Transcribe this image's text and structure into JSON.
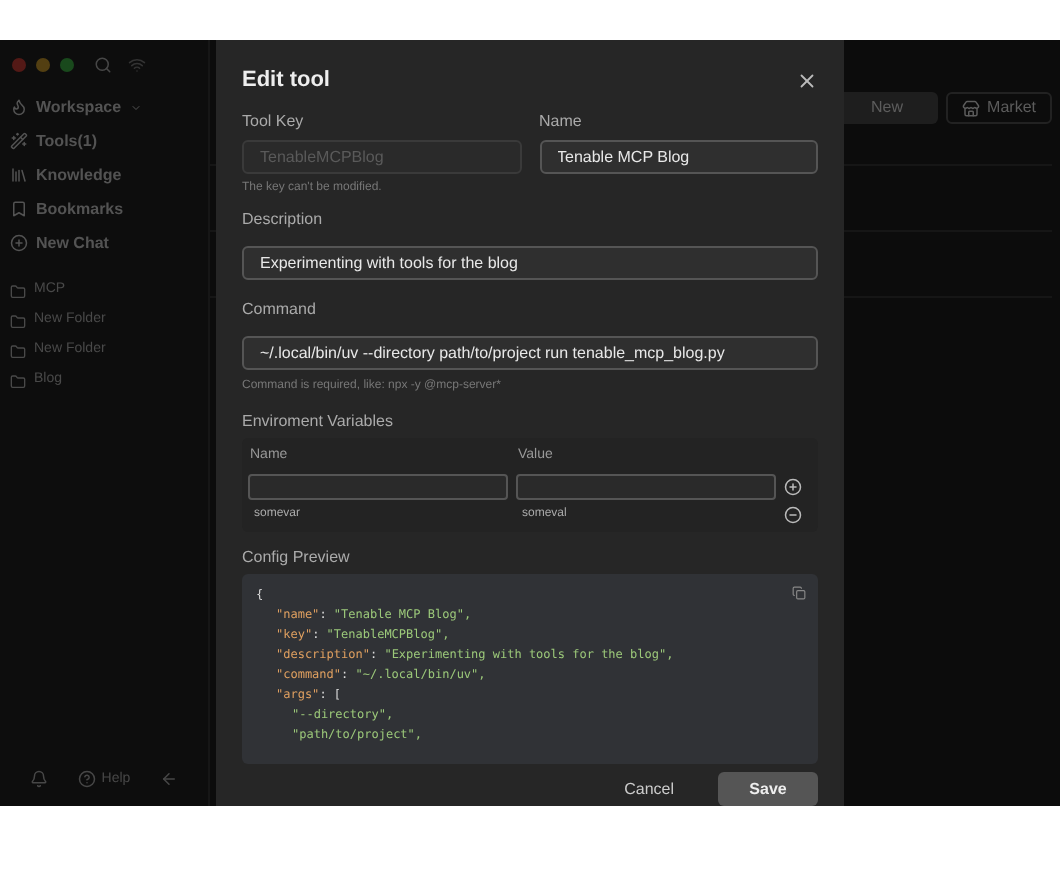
{
  "sidebar": {
    "items": [
      {
        "kind": "workspace",
        "label": "Workspace"
      },
      {
        "kind": "tools",
        "label": "Tools(1)"
      },
      {
        "kind": "knowledge",
        "label": "Knowledge"
      },
      {
        "kind": "bookmarks",
        "label": "Bookmarks"
      },
      {
        "kind": "new-chat",
        "label": "New Chat"
      }
    ],
    "folders": [
      "MCP",
      "New Folder",
      "New Folder",
      "Blog"
    ],
    "footer": {
      "help": "Help"
    }
  },
  "toolbar": {
    "new": "New",
    "market": "Market"
  },
  "dialog": {
    "title": "Edit tool",
    "tool_key": {
      "label": "Tool Key",
      "placeholder": "TenableMCPBlog",
      "disabled": true,
      "hint": "The key can't be modified."
    },
    "name": {
      "label": "Name",
      "value": "Tenable MCP Blog"
    },
    "description": {
      "label": "Description",
      "value": "Experimenting with tools for the blog"
    },
    "command": {
      "label": "Command",
      "value": "~/.local/bin/uv --directory path/to/project run tenable_mcp_blog.py",
      "hint": "Command is required, like: npx -y @mcp-server*"
    },
    "env": {
      "label": "Enviroment Variables",
      "columns": [
        "Name",
        "Value"
      ],
      "rows": [
        {
          "name": "somevar",
          "value": "someval"
        }
      ]
    },
    "preview": {
      "label": "Config Preview",
      "lines": [
        {
          "kind": "brace",
          "text": "{"
        },
        {
          "kind": "pair",
          "key": "\"name\"",
          "sep": ": ",
          "value": "\"Tenable MCP Blog\","
        },
        {
          "kind": "pair",
          "key": "\"key\"",
          "sep": ": ",
          "value": "\"TenableMCPBlog\","
        },
        {
          "kind": "pair",
          "key": "\"description\"",
          "sep": ": ",
          "value": "\"Experimenting with tools for the blog\","
        },
        {
          "kind": "pair",
          "key": "\"command\"",
          "sep": ": ",
          "value": "\"~/.local/bin/uv\","
        },
        {
          "kind": "open",
          "key": "\"args\"",
          "sep": ": ",
          "value": "["
        },
        {
          "kind": "item",
          "value": "\"--directory\","
        },
        {
          "kind": "item",
          "value": "\"path/to/project\","
        }
      ]
    },
    "buttons": {
      "cancel": "Cancel",
      "save": "Save"
    }
  }
}
